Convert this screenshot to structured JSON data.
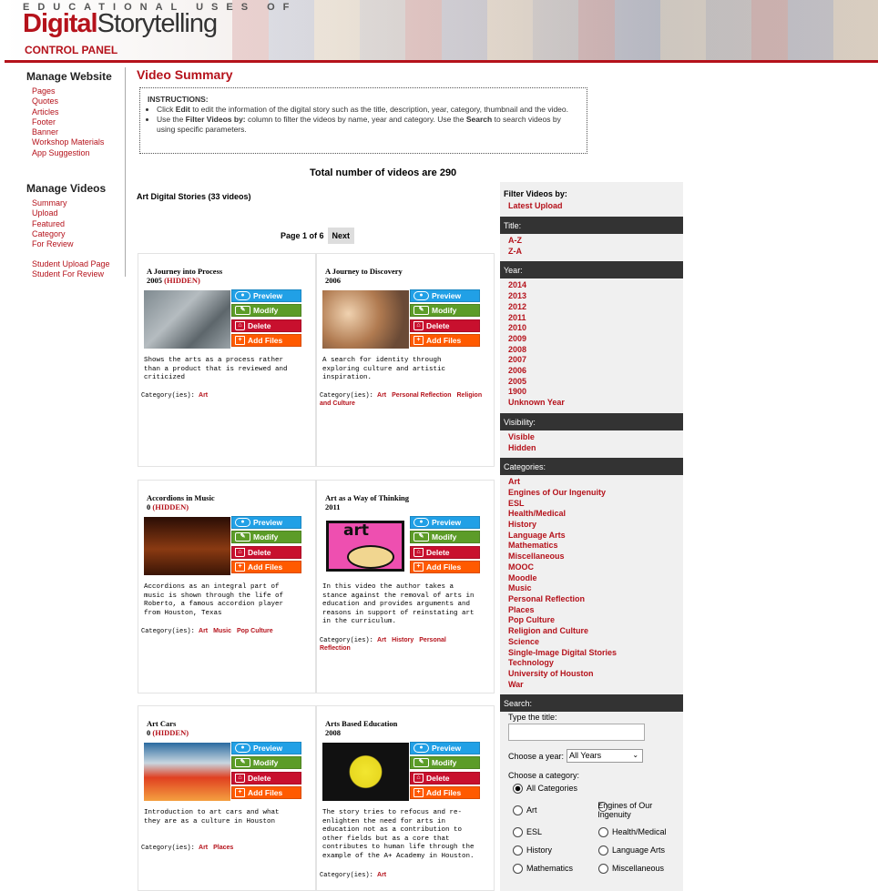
{
  "header": {
    "tagline": "EDUCATIONAL USES OF",
    "logo_digital": "Digital",
    "logo_story": "Storytelling",
    "control_panel": "CONTROL PANEL"
  },
  "sidebar": {
    "website_heading": "Manage Website",
    "website_items": [
      "Pages",
      "Quotes",
      "Articles",
      "Footer",
      "Banner",
      "Workshop Materials",
      "App Suggestion"
    ],
    "videos_heading": "Manage Videos",
    "video_items": [
      "Summary",
      "Upload",
      "Featured",
      "Category",
      "For Review"
    ],
    "student_items": [
      "Student Upload Page",
      "Student For Review"
    ]
  },
  "main": {
    "title": "Video Summary",
    "instructions_heading": "INSTRUCTIONS:",
    "instr1_a": "Click ",
    "instr1_b": "Edit",
    "instr1_c": " to edit the information of the digital story such as the title, description, year, category, thumbnail and the video.",
    "instr2_a": "Use the ",
    "instr2_b": "Filter Videos by:",
    "instr2_c": " column to filter the videos by name, year and category. Use the ",
    "instr2_d": "Search",
    "instr2_e": " to search videos by using specific parameters.",
    "total": "Total number of videos are 290",
    "section": "Art Digital Stories (33 videos)",
    "page_info": "Page 1 of 6",
    "next": "Next",
    "buttons": {
      "preview": "Preview",
      "modify": "Modify",
      "delete": "Delete",
      "add_files": "Add Files"
    },
    "categories_label": "Category(ies): ",
    "hidden_label": "(HIDDEN)"
  },
  "videos": [
    {
      "title": "A Journey into Process",
      "year": "2005",
      "hidden": true,
      "desc": "Shows the arts as a process rather than a product that is reviewed and criticized",
      "cats": [
        "Art"
      ]
    },
    {
      "title": "A Journey to Discovery",
      "year": "2006",
      "hidden": false,
      "desc": "A search for identity through exploring culture and artistic inspiration.",
      "cats": [
        "Art",
        "Personal Reflection",
        "Religion and Culture"
      ]
    },
    {
      "title": "Accordions in Music",
      "year": "0",
      "hidden": true,
      "desc": "Accordions as an integral part of music is shown through the life of Roberto, a famous accordion player from Houston, Texas",
      "cats": [
        "Art",
        "Music",
        "Pop Culture"
      ]
    },
    {
      "title": "Art as a Way of Thinking",
      "year": "2011",
      "hidden": false,
      "desc": "In this video the author takes a stance against the removal of arts in education and provides arguments and reasons in support of reinstating art in the curriculum.",
      "cats": [
        "Art",
        "History",
        "Personal Reflection"
      ]
    },
    {
      "title": "Art Cars",
      "year": "0",
      "hidden": true,
      "desc": "Introduction to art cars and what they are as a culture in Houston",
      "cats": [
        "Art",
        "Places"
      ]
    },
    {
      "title": "Arts Based Education",
      "year": "2008",
      "hidden": false,
      "desc": "The story tries to refocus and re-enlighten the need for arts in education not as a contribution to other fields but as a core that contributes to human life through the example of the A+ Academy in Houston.",
      "cats": [
        "Art"
      ]
    }
  ],
  "filter": {
    "heading": "Filter Videos by:",
    "latest": "Latest Upload",
    "title_bar": "Title:",
    "title_items": [
      "A-Z",
      "Z-A"
    ],
    "year_bar": "Year:",
    "years": [
      "2014",
      "2013",
      "2012",
      "2011",
      "2010",
      "2009",
      "2008",
      "2007",
      "2006",
      "2005",
      "1900",
      "Unknown Year"
    ],
    "vis_bar": "Visibility:",
    "visibility": [
      "Visible",
      "Hidden"
    ],
    "cat_bar": "Categories:",
    "categories": [
      "Art",
      "Engines of Our Ingenuity",
      "ESL",
      "Health/Medical",
      "History",
      "Language Arts",
      "Mathematics",
      "Miscellaneous",
      "MOOC",
      "Moodle",
      "Music",
      "Personal Reflection",
      "Places",
      "Pop Culture",
      "Religion and Culture",
      "Science",
      "Single-Image Digital Stories",
      "Technology",
      "University of Houston",
      "War"
    ],
    "search_bar": "Search:",
    "type_title": "Type the title:",
    "title_value": "",
    "choose_year": "Choose a year:",
    "year_selected": "All Years",
    "choose_cat": "Choose a category:",
    "radio": {
      "all": "All Categories",
      "art": "Art",
      "engines": "Engines of Our Ingenuity",
      "esl": "ESL",
      "health": "Health/Medical",
      "history": "History",
      "lang": "Language Arts",
      "math": "Mathematics",
      "misc": "Miscellaneous"
    }
  },
  "colors": {
    "brand_red": "#b5121b",
    "preview": "#21a0e6",
    "modify": "#5c9c28",
    "delete": "#c8102e",
    "add_files": "#ff5a00",
    "filter_bar": "#333333"
  }
}
